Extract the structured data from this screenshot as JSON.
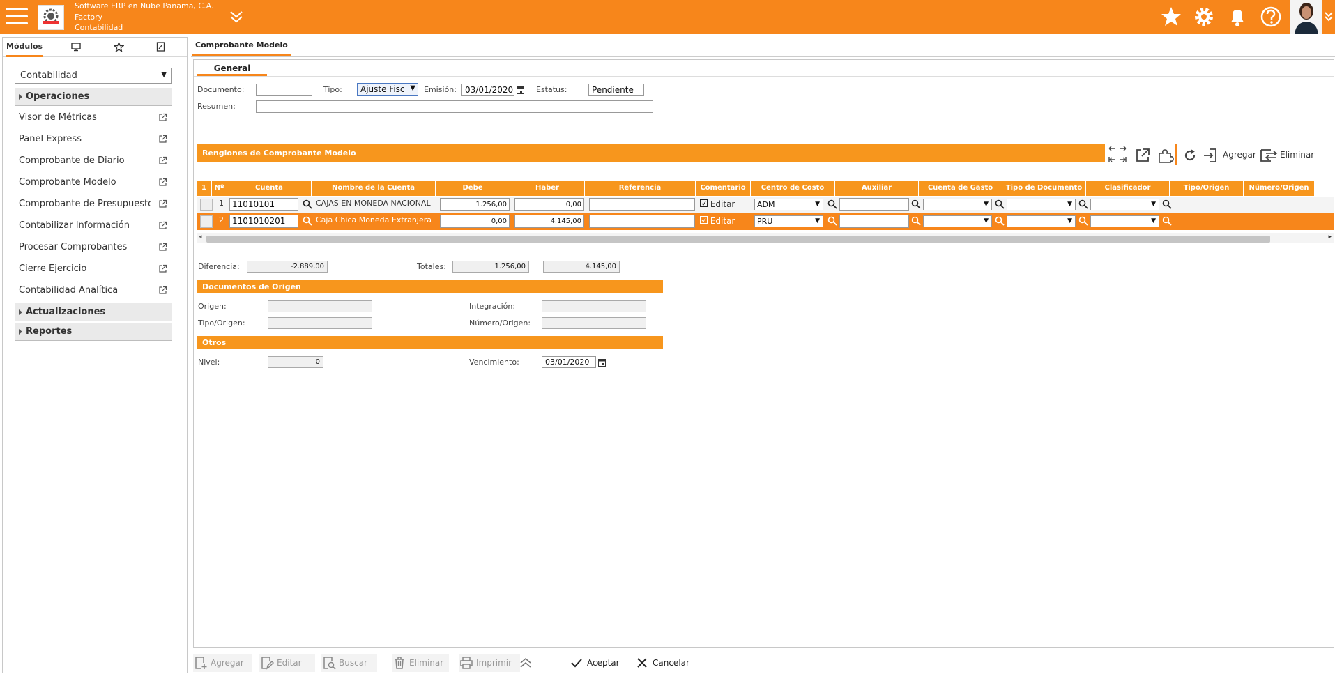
{
  "header": {
    "company_line1": "Software ERP en Nube Panama, C.A.",
    "company_line2": "Factory",
    "company_line3": "Contabilidad",
    "brand_color": "#f7861b"
  },
  "sidebar": {
    "tab_modulos": "Módulos",
    "module_selected": "Contabilidad",
    "section_operaciones": "Operaciones",
    "items": [
      {
        "label": "Visor de Métricas"
      },
      {
        "label": "Panel Express"
      },
      {
        "label": "Comprobante de Diario"
      },
      {
        "label": "Comprobante Modelo"
      },
      {
        "label": "Comprobante de Presupuesto"
      },
      {
        "label": "Contabilizar Información"
      },
      {
        "label": "Procesar Comprobantes"
      },
      {
        "label": "Cierre Ejercicio"
      },
      {
        "label": "Contabilidad Analítica"
      }
    ],
    "section_actualizaciones": "Actualizaciones",
    "section_reportes": "Reportes"
  },
  "main": {
    "tab_title": "Comprobante Modelo",
    "subtab": "General"
  },
  "form": {
    "documento_label": "Documento:",
    "documento_value": "",
    "tipo_label": "Tipo:",
    "tipo_value": "Ajuste Fisc",
    "emision_label": "Emisión:",
    "emision_value": "03/01/2020",
    "estatus_label": "Estatus:",
    "estatus_value": "Pendiente",
    "resumen_label": "Resumen:",
    "resumen_value": ""
  },
  "grid": {
    "title": "Renglones de Comprobante Modelo",
    "agregar": "Agregar",
    "eliminar": "Eliminar",
    "columns": [
      "1",
      "Nº",
      "Cuenta",
      "Nombre de la Cuenta",
      "Debe",
      "Haber",
      "Referencia",
      "Comentario",
      "Centro de Costo",
      "Auxiliar",
      "Cuenta de Gasto",
      "Tipo de Documento",
      "Clasificador",
      "Tipo/Origen",
      "Número/Origen"
    ],
    "editar_label": "Editar",
    "rows": [
      {
        "n": "1",
        "cuenta": "11010101",
        "nombre": "CAJAS EN MONEDA NACIONAL",
        "debe": "1.256,00",
        "haber": "0,00",
        "referencia": "",
        "centro": "ADM"
      },
      {
        "n": "2",
        "cuenta": "1101010201",
        "nombre": "Caja Chica Moneda Extranjera",
        "debe": "0,00",
        "haber": "4.145,00",
        "referencia": "",
        "centro": "PRU"
      }
    ]
  },
  "totals": {
    "diferencia_label": "Diferencia:",
    "diferencia_value": "-2.889,00",
    "totales_label": "Totales:",
    "total_debe": "1.256,00",
    "total_haber": "4.145,00"
  },
  "origen": {
    "title": "Documentos de Origen",
    "origen_label": "Origen:",
    "integracion_label": "Integración:",
    "tipo_origen_label": "Tipo/Origen:",
    "numero_origen_label": "Número/Origen:"
  },
  "otros": {
    "title": "Otros",
    "nivel_label": "Nivel:",
    "nivel_value": "0",
    "vencimiento_label": "Vencimiento:",
    "vencimiento_value": "03/01/2020"
  },
  "actions": {
    "agregar": "Agregar",
    "editar": "Editar",
    "buscar": "Buscar",
    "eliminar": "Eliminar",
    "imprimir": "Imprimir",
    "aceptar": "Aceptar",
    "cancelar": "Cancelar"
  }
}
